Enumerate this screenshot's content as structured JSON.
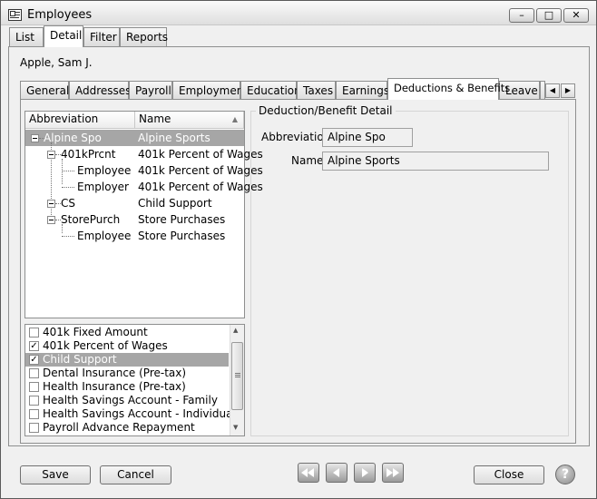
{
  "window": {
    "title": "Employees",
    "icon": "employee-list-icon"
  },
  "top_tabs": [
    {
      "label": "List",
      "active": false
    },
    {
      "label": "Detail",
      "active": true
    },
    {
      "label": "Filter",
      "active": false
    },
    {
      "label": "Reports",
      "active": false
    }
  ],
  "employee_name": "Apple, Sam J.",
  "sub_tabs": [
    {
      "label": "General"
    },
    {
      "label": "Addresses"
    },
    {
      "label": "Payroll"
    },
    {
      "label": "Employment"
    },
    {
      "label": "Education"
    },
    {
      "label": "Taxes"
    },
    {
      "label": "Earnings"
    },
    {
      "label": "Deductions & Benefits",
      "active": true
    },
    {
      "label": "Leave"
    }
  ],
  "tree": {
    "headers": [
      "Abbreviation",
      "Name"
    ],
    "rows": [
      {
        "abbr": "Alpine Spo",
        "name": "Alpine Sports",
        "level": 0,
        "selected": true
      },
      {
        "abbr": "401kPrcnt",
        "name": "401k Percent of Wages",
        "level": 1
      },
      {
        "abbr": "Employee",
        "name": "401k Percent of Wages",
        "level": 2
      },
      {
        "abbr": "Employer",
        "name": "401k Percent of Wages",
        "level": 2
      },
      {
        "abbr": "CS",
        "name": "Child Support",
        "level": 1
      },
      {
        "abbr": "StorePurch",
        "name": "Store Purchases",
        "level": 1
      },
      {
        "abbr": "Employee",
        "name": "Store Purchases",
        "level": 2
      }
    ]
  },
  "checklist": [
    {
      "label": "401k Fixed Amount",
      "checked": false
    },
    {
      "label": "401k Percent of Wages",
      "checked": true
    },
    {
      "label": "Child Support",
      "checked": true,
      "selected": true
    },
    {
      "label": "Dental Insurance (Pre-tax)",
      "checked": false
    },
    {
      "label": "Health Insurance (Pre-tax)",
      "checked": false
    },
    {
      "label": "Health Savings Account - Family",
      "checked": false
    },
    {
      "label": "Health Savings Account - Individual",
      "checked": false
    },
    {
      "label": "Payroll Advance Repayment",
      "checked": false
    }
  ],
  "detail": {
    "group_title": "Deduction/Benefit Detail",
    "abbreviation_label": "Abbreviation",
    "abbreviation_value": "Alpine Spo",
    "name_label": "Name",
    "name_value": "Alpine Sports"
  },
  "buttons": {
    "save": "Save",
    "cancel": "Cancel",
    "close": "Close"
  },
  "glyphs": {
    "check": "✓",
    "sort_up": "▲",
    "scroll_up": "▲",
    "scroll_down": "▼",
    "tab_left": "◀",
    "tab_right": "▶",
    "help": "?",
    "minimize": "–",
    "restore": "□",
    "close": "✕"
  },
  "colors": {
    "selection": "#a6a6a6",
    "title_bar": "#e6e6e6",
    "nav_button": "#a0a0a0"
  }
}
